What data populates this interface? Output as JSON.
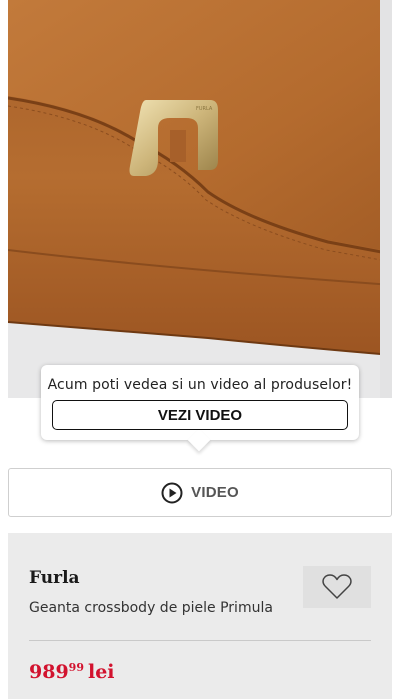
{
  "product_image": {
    "icon": "handbag-photo"
  },
  "video_tooltip": {
    "message": "Acum poti vedea si un video al produselor!",
    "cta_label": "VEZI VIDEO"
  },
  "video_button": {
    "label": "VIDEO",
    "icon": "play-circle-icon"
  },
  "product": {
    "brand": "Furla",
    "name": "Geanta crossbody de piele Primula",
    "price_integer": "989",
    "price_decimals": "99",
    "currency": "lei",
    "wishlist_icon": "heart-icon"
  },
  "colors": {
    "leather": "#b36a2c",
    "price": "#d2122e",
    "card_bg": "#ebebeb",
    "hardware_gold": "#d9c48c"
  }
}
